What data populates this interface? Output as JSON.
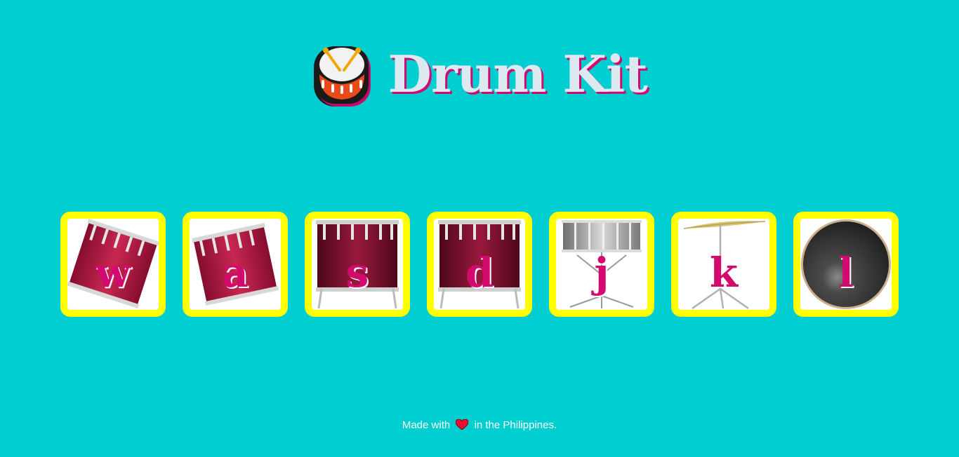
{
  "header": {
    "logo_icon": "drum-emoji-icon",
    "title": "Drum Kit"
  },
  "drums": [
    {
      "key": "w",
      "icon": "tilted-tom-drum-icon"
    },
    {
      "key": "a",
      "icon": "tilted-tom-drum-icon"
    },
    {
      "key": "s",
      "icon": "floor-tom-drum-icon"
    },
    {
      "key": "d",
      "icon": "floor-tom-drum-icon"
    },
    {
      "key": "j",
      "icon": "snare-drum-icon"
    },
    {
      "key": "k",
      "icon": "cymbal-icon"
    },
    {
      "key": "l",
      "icon": "bass-drum-head-icon"
    }
  ],
  "footer": {
    "before": "Made with",
    "heart_icon": "heart-icon",
    "after": "in the Philippines."
  },
  "colors": {
    "background": "#00ced1",
    "border": "#ffff00",
    "key_text": "#d4096f",
    "title_text": "#dde9f0",
    "drum_red": "#b01a44",
    "heart": "#e8102e"
  }
}
